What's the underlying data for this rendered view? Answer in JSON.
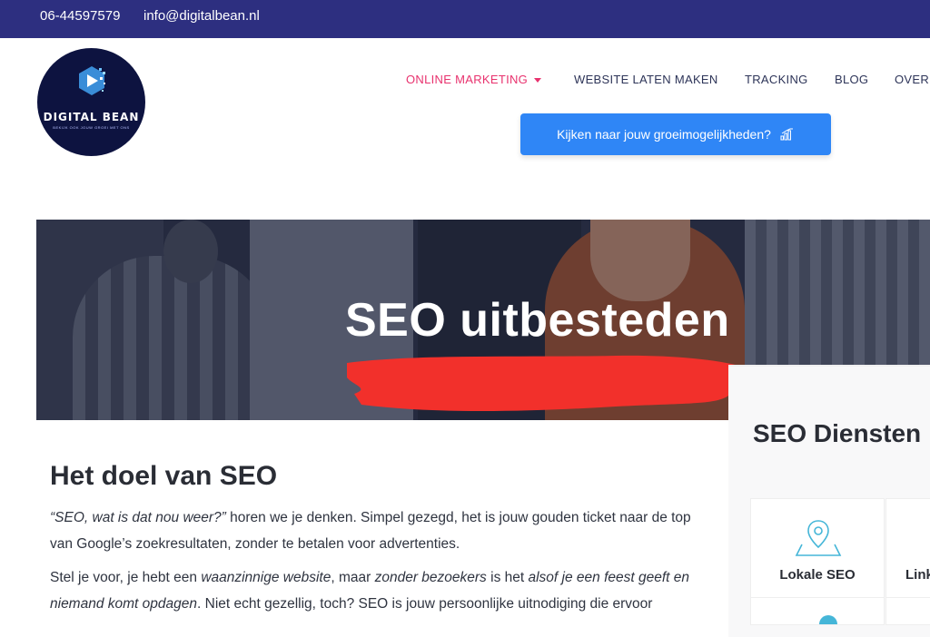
{
  "topbar": {
    "phone": "06-44597579",
    "email": "info@digitalbean.nl",
    "background": "#2d2f80"
  },
  "logo": {
    "name": "DIGITAL BEAN",
    "tagline": "BEKIJK OOK JOUW GROEI MET ONS",
    "icon": "play-triangle-logo-icon"
  },
  "nav": {
    "items": [
      {
        "label": "ONLINE MARKETING",
        "active": true,
        "has_dropdown": true
      },
      {
        "label": "WEBSITE LATEN MAKEN"
      },
      {
        "label": "TRACKING"
      },
      {
        "label": "BLOG"
      },
      {
        "label": "OVER"
      }
    ],
    "active_color": "#e8326e"
  },
  "cta": {
    "label": "Kijken naar jouw groeimogelijkheden?",
    "icon": "growth-chart-icon",
    "color": "#2f86f6"
  },
  "hero": {
    "title": "SEO uitbesteden",
    "underline_color": "#f2302b"
  },
  "services": {
    "title": "SEO Diensten",
    "items": [
      {
        "label": "Lokale SEO",
        "icon": "map-pin-icon"
      },
      {
        "label": "Link"
      }
    ]
  },
  "article": {
    "heading": "Het doel van SEO",
    "p1_quote": "“SEO, wat is dat nou weer?”",
    "p1_rest": " horen we je denken. Simpel gezegd, het is jouw gouden ticket naar de top van Google’s zoekresultaten, zonder te betalen voor advertenties.",
    "p2_a": "Stel je voor, je hebt een ",
    "p2_b": "waanzinnige website",
    "p2_c": ", maar ",
    "p2_d": "zonder bezoekers",
    "p2_e": " is het ",
    "p2_f": "alsof je een feest geeft en niemand komt opdagen",
    "p2_g": ". Niet echt gezellig, toch? SEO is jouw persoonlijke uitnodiging die ervoor"
  }
}
